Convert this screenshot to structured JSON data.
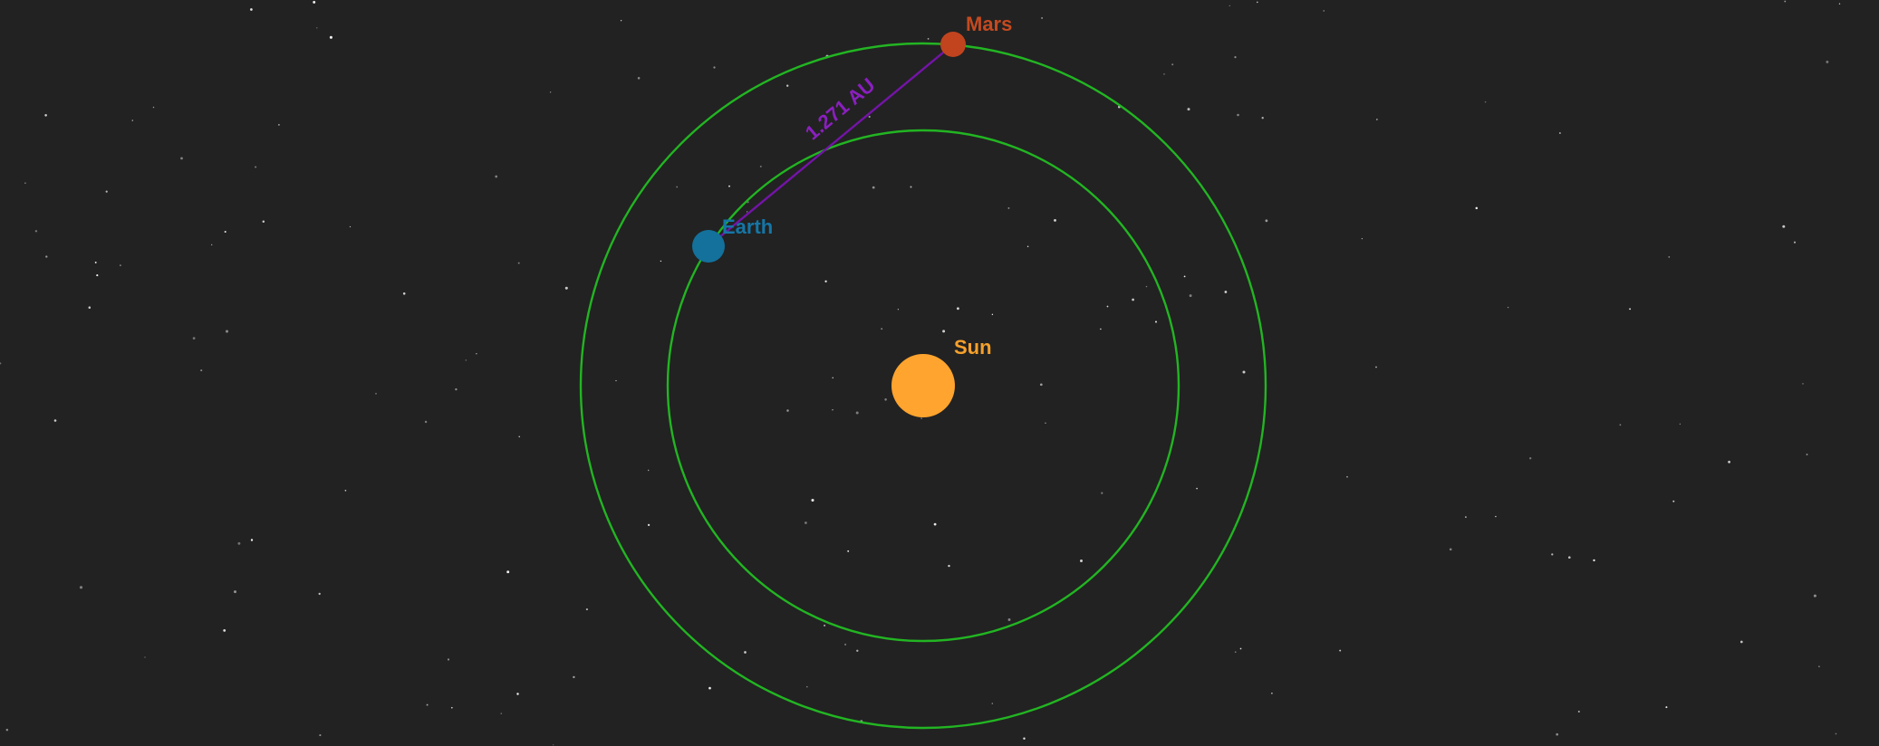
{
  "colors": {
    "background": "#222222",
    "star": "#ffffff",
    "orbit": "#22b522",
    "sun": "#ffa42e",
    "sun_label": "#f5a02c",
    "earth": "#13719c",
    "earth_label": "#1576a6",
    "mars": "#c1441e",
    "mars_label": "#c44a20",
    "distance_line": "#7414a8",
    "distance_label": "#8a1fbf"
  },
  "bodies": {
    "sun": {
      "label": "Sun"
    },
    "earth": {
      "label": "Earth"
    },
    "mars": {
      "label": "Mars"
    }
  },
  "distance": {
    "label": "1.271 AU"
  }
}
